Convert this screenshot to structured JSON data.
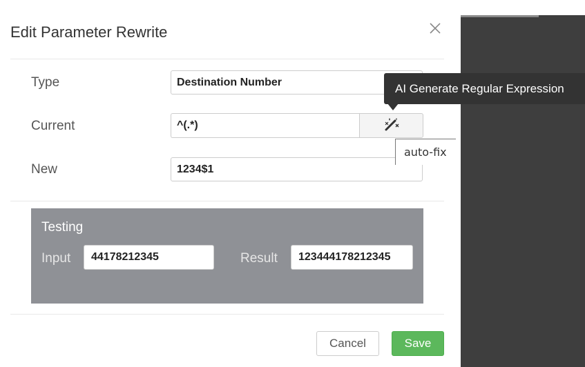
{
  "dialog": {
    "title": "Edit Parameter Rewrite",
    "close_icon": "close-icon"
  },
  "fields": {
    "type": {
      "label": "Type",
      "value": "Destination Number"
    },
    "current": {
      "label": "Current",
      "value": "^(.*)",
      "button_icon": "magic-wand-icon"
    },
    "new": {
      "label": "New",
      "value": "1234$1"
    }
  },
  "tooltips": {
    "ai": "AI Generate Regular Expression",
    "autofix": "auto-fix"
  },
  "testing": {
    "title": "Testing",
    "input_label": "Input",
    "input_value": "44178212345",
    "result_label": "Result",
    "result_value": "123444178212345"
  },
  "footer": {
    "cancel_label": "Cancel",
    "save_label": "Save"
  },
  "colors": {
    "save": "#5cb85c",
    "testing_bg": "#8f9196",
    "tooltip_bg": "#333333",
    "side_panel": "#3e3e3e"
  }
}
